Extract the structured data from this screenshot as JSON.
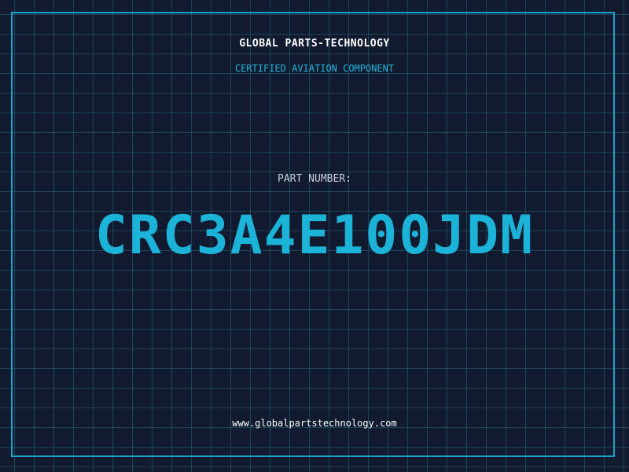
{
  "header": {
    "company": "GLOBAL PARTS-TECHNOLOGY",
    "subtitle": "CERTIFIED AVIATION COMPONENT"
  },
  "part": {
    "label": "PART NUMBER:",
    "number": "CRC3A4E100JDM"
  },
  "footer": {
    "website": "www.globalpartstechnology.com"
  },
  "colors": {
    "background": "#111a2e",
    "grid": "#28788c",
    "accent": "#1cb3d9",
    "text": "#ffffff"
  }
}
